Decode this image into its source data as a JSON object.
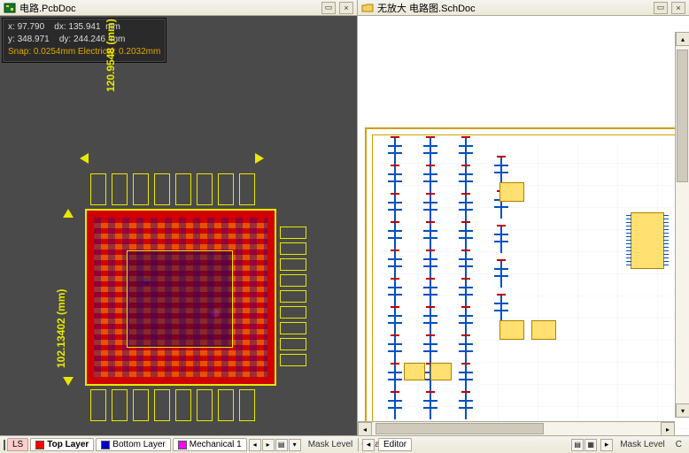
{
  "left": {
    "title": "电路.PcbDoc",
    "coord": {
      "x_label": "x:",
      "x_val": "97.790",
      "dx_label": "dx:",
      "dx_val": "135.941",
      "dx_unit": "mm",
      "y_label": "y:",
      "y_val": "348.971",
      "dy_label": "dy:",
      "dy_val": "244.246",
      "dy_unit": "mm",
      "snap": "Snap: 0.0254mm Electrical: 0.2032mm"
    },
    "dim_h": "120.9548 (mm)",
    "dim_v": "102.13402 (mm)",
    "layers": {
      "ls": "LS",
      "top": "Top Layer",
      "bottom": "Bottom Layer",
      "mech": "Mechanical 1"
    },
    "mask": "Mask Level",
    "clear": "Clear"
  },
  "right": {
    "title": "无放大 电路图.SchDoc",
    "editor": "Editor",
    "mask": "Mask Level",
    "clear": "C"
  },
  "colors": {
    "top": "#ff0000",
    "bottom": "#0000c0",
    "mech": "#ff00ff",
    "ls_bg": "#ffcccc"
  }
}
